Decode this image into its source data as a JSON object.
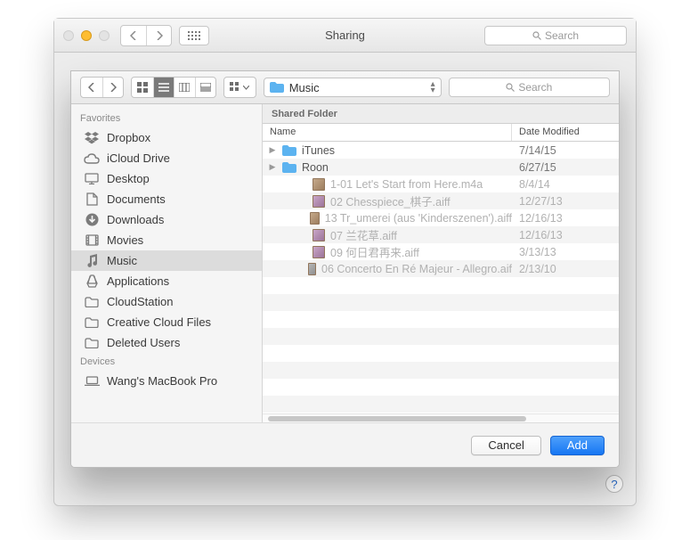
{
  "parent_window": {
    "title": "Sharing",
    "search_placeholder": "Search"
  },
  "sheet": {
    "header": "Shared Folder",
    "path_selector": "Music",
    "search_placeholder": "Search",
    "columns": {
      "name": "Name",
      "date": "Date Modified"
    },
    "cancel": "Cancel",
    "add": "Add"
  },
  "sidebar": {
    "groups": [
      {
        "label": "Favorites",
        "items": [
          {
            "icon": "dropbox",
            "label": "Dropbox"
          },
          {
            "icon": "cloud",
            "label": "iCloud Drive"
          },
          {
            "icon": "desktop",
            "label": "Desktop"
          },
          {
            "icon": "documents",
            "label": "Documents"
          },
          {
            "icon": "downloads",
            "label": "Downloads"
          },
          {
            "icon": "movies",
            "label": "Movies"
          },
          {
            "icon": "music",
            "label": "Music",
            "selected": true
          },
          {
            "icon": "applications",
            "label": "Applications"
          },
          {
            "icon": "folder",
            "label": "CloudStation"
          },
          {
            "icon": "folder",
            "label": "Creative Cloud Files"
          },
          {
            "icon": "folder",
            "label": "Deleted Users"
          }
        ]
      },
      {
        "label": "Devices",
        "items": [
          {
            "icon": "laptop",
            "label": "Wang's MacBook Pro"
          }
        ]
      }
    ]
  },
  "files": [
    {
      "kind": "folder",
      "name": "iTunes",
      "date": "7/14/15",
      "expandable": true,
      "dim": false
    },
    {
      "kind": "folder",
      "name": "Roon",
      "date": "6/27/15",
      "expandable": true,
      "dim": false
    },
    {
      "kind": "file",
      "name": "1-01 Let's Start from Here.m4a",
      "date": "8/4/14",
      "dim": true,
      "v": "a"
    },
    {
      "kind": "file",
      "name": "02 Chesspiece_棋子.aiff",
      "date": "12/27/13",
      "dim": true,
      "v": "b"
    },
    {
      "kind": "file",
      "name": "13 Tr_umerei (aus 'Kinderszenen').aiff",
      "date": "12/16/13",
      "dim": true,
      "v": "a"
    },
    {
      "kind": "file",
      "name": "07 兰花草.aiff",
      "date": "12/16/13",
      "dim": true,
      "v": "b"
    },
    {
      "kind": "file",
      "name": "09 何日君再来.aiff",
      "date": "3/13/13",
      "dim": true,
      "v": "b"
    },
    {
      "kind": "file",
      "name": "06 Concerto En Ré Majeur - Allegro.aif",
      "date": "2/13/10",
      "dim": true,
      "v": "c"
    }
  ]
}
